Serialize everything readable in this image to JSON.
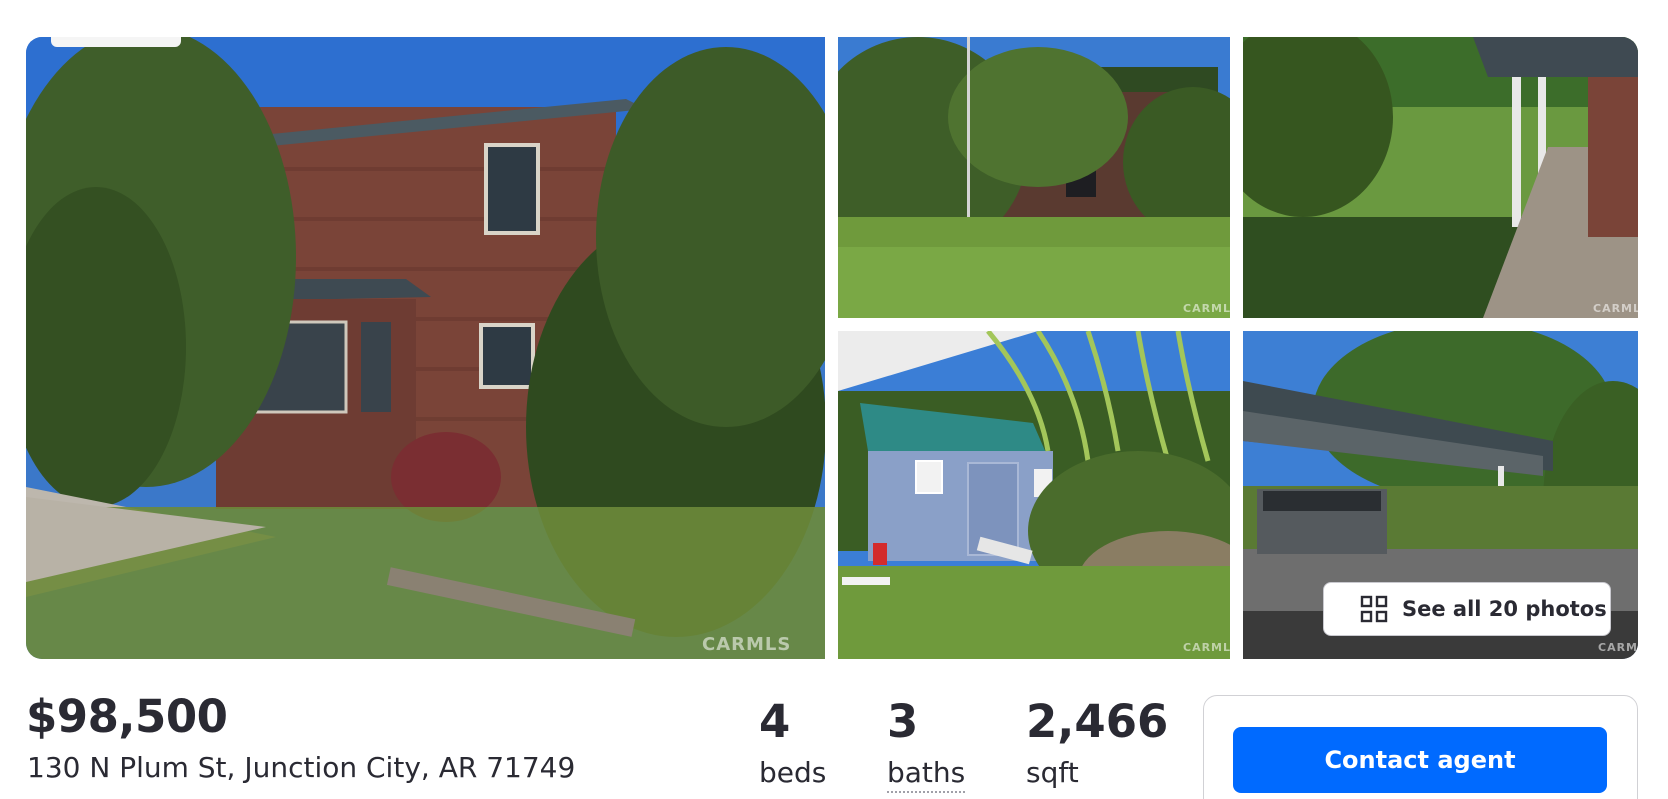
{
  "gallery": {
    "photos": [
      {
        "description_icon": "house-exterior-photo"
      },
      {
        "description_icon": "front-yard-photo"
      },
      {
        "description_icon": "porch-walkway-photo"
      },
      {
        "description_icon": "shed-photo"
      },
      {
        "description_icon": "carport-photo"
      }
    ],
    "watermark": "CARMLS",
    "see_all_label": "See all 20 photos",
    "photo_count": 20
  },
  "listing": {
    "price": "$98,500",
    "address": "130 N Plum St, Junction City, AR 71749",
    "beds_value": "4",
    "beds_label": "beds",
    "baths_value": "3",
    "baths_label": "baths",
    "sqft_value": "2,466",
    "sqft_label": "sqft"
  },
  "contact": {
    "button_label": "Contact agent"
  },
  "colors": {
    "accent": "#006aff",
    "text": "#2a2a33"
  }
}
